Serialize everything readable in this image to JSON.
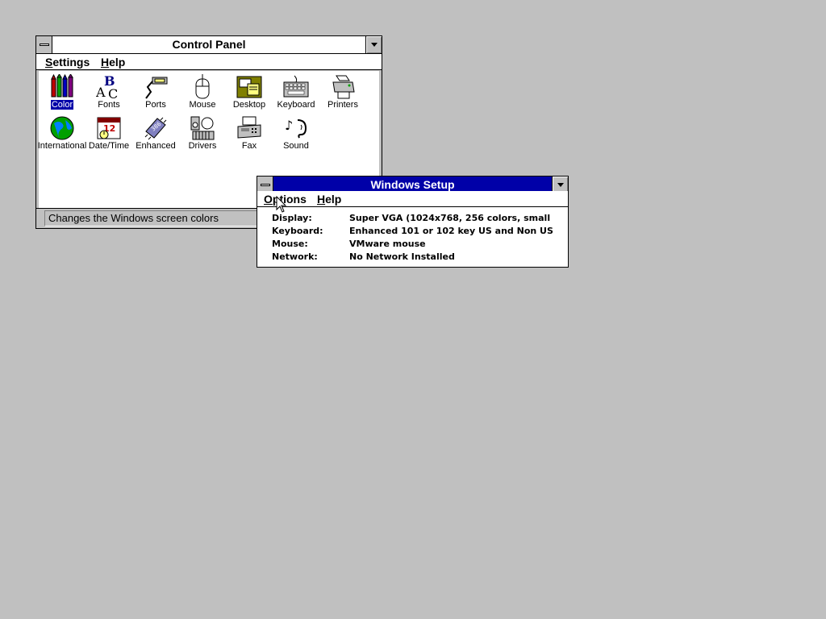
{
  "control_panel": {
    "title": "Control Panel",
    "menu": [
      {
        "label_u": "S",
        "label_rest": "ettings"
      },
      {
        "label_u": "H",
        "label_rest": "elp"
      }
    ],
    "icons": [
      {
        "label": "Color",
        "icon": "color-icon",
        "selected": true
      },
      {
        "label": "Fonts",
        "icon": "fonts-icon"
      },
      {
        "label": "Ports",
        "icon": "ports-icon"
      },
      {
        "label": "Mouse",
        "icon": "mouse-icon"
      },
      {
        "label": "Desktop",
        "icon": "desktop-icon"
      },
      {
        "label": "Keyboard",
        "icon": "keyboard-icon"
      },
      {
        "label": "Printers",
        "icon": "printers-icon"
      },
      {
        "label": "International",
        "icon": "globe-icon"
      },
      {
        "label": "Date/Time",
        "icon": "calendar-clock-icon"
      },
      {
        "label": "Enhanced",
        "icon": "chip-icon"
      },
      {
        "label": "Drivers",
        "icon": "drivers-icon"
      },
      {
        "label": "Fax",
        "icon": "fax-icon"
      },
      {
        "label": "Sound",
        "icon": "sound-icon"
      }
    ],
    "status": "Changes the Windows screen colors"
  },
  "setup": {
    "title": "Windows Setup",
    "menu": [
      {
        "label_u": "O",
        "label_rest": "ptions"
      },
      {
        "label_u": "H",
        "label_rest": "elp"
      }
    ],
    "rows": [
      {
        "label": "Display:",
        "value": "Super VGA (1024x768, 256 colors, small"
      },
      {
        "label": "Keyboard:",
        "value": "Enhanced 101 or 102 key US and Non US"
      },
      {
        "label": "Mouse:",
        "value": "VMware mouse"
      },
      {
        "label": "Network:",
        "value": "No Network Installed"
      }
    ]
  },
  "colors": {
    "desktop": "#c0c0c0",
    "active_title": "#0000a8",
    "selection": "#0000a8"
  }
}
